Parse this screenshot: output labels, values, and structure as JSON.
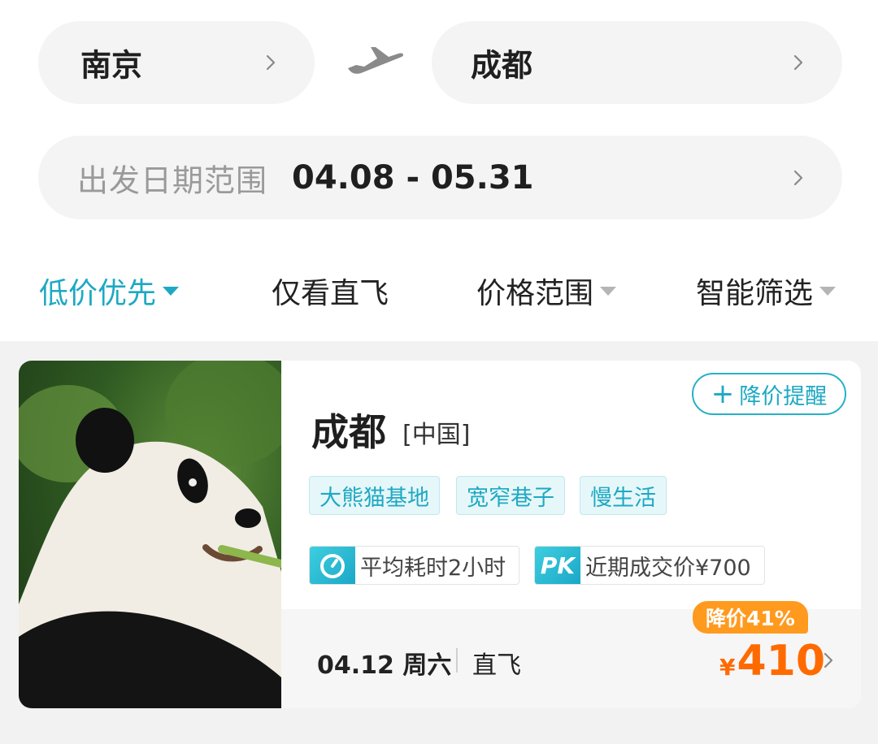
{
  "route": {
    "from_city": "南京",
    "to_city": "成都"
  },
  "date_range": {
    "label": "出发日期范围",
    "value": "04.08 - 05.31"
  },
  "filters": [
    {
      "label": "低价优先",
      "active": true,
      "has_dropdown": true
    },
    {
      "label": "仅看直飞",
      "active": false,
      "has_dropdown": false
    },
    {
      "label": "价格范围",
      "active": false,
      "has_dropdown": true
    },
    {
      "label": "智能筛选",
      "active": false,
      "has_dropdown": true
    }
  ],
  "card": {
    "remind_button": "降价提醒",
    "destination": "成都",
    "country": "[中国]",
    "tags": [
      "大熊猫基地",
      "宽窄巷子",
      "慢生活"
    ],
    "avg_time": "平均耗时2小时",
    "recent_price": "近期成交价¥700",
    "pk_badge": "PK",
    "flight_date": "04.12 周六",
    "flight_type": "直飞",
    "discount": "降价41%",
    "currency": "¥",
    "price": "410"
  },
  "colors": {
    "accent": "#1ea9c3",
    "price": "#ff6a00",
    "discount_badge": "#ff9a1f"
  },
  "icons": [
    "chevron-right-icon",
    "airplane-icon",
    "dropdown-triangle-icon",
    "plus-icon",
    "timer-icon",
    "panda-photo"
  ]
}
